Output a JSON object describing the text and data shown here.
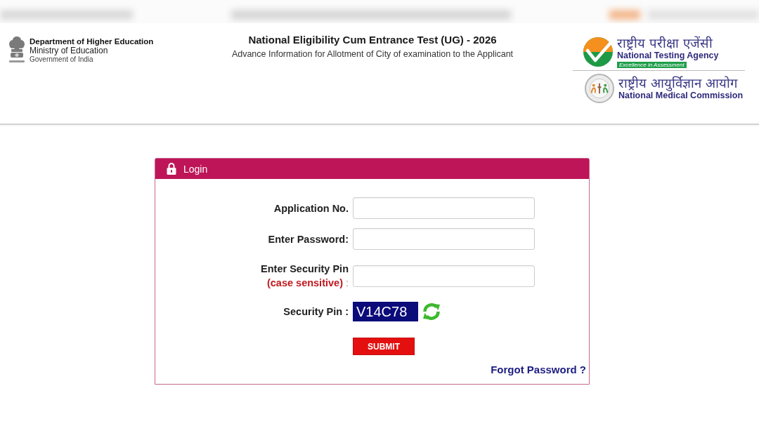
{
  "header": {
    "department": {
      "name": "Department of Higher Education",
      "ministry": "Ministry of Education",
      "government": "Government of India"
    },
    "exam_title": "National Eligibility Cum Entrance Test (UG) - 2026",
    "exam_subtitle": "Advance Information for Allotment of City of examination to the Applicant",
    "agencies": [
      {
        "kind": "check",
        "hindi": "राष्ट्रीय परीक्षा एजेंसी",
        "english": "National Testing Agency",
        "tagline": "Excellence in Assessment"
      },
      {
        "kind": "seal",
        "hindi": "राष्ट्रीय आयुर्विज्ञान आयोग",
        "english": "National Medical Commission"
      }
    ]
  },
  "login": {
    "title": "Login",
    "fields": [
      {
        "kind": "input",
        "label": "Application No."
      },
      {
        "kind": "input",
        "label": "Enter Password:"
      },
      {
        "kind": "input",
        "label": "Enter Security Pin",
        "note": "(case sensitive)",
        "suffix": ":"
      },
      {
        "kind": "captcha",
        "label": "Security Pin :",
        "code": "V14C78"
      }
    ],
    "submit": "SUBMIT",
    "forgot_password": "Forgot Password ?"
  }
}
